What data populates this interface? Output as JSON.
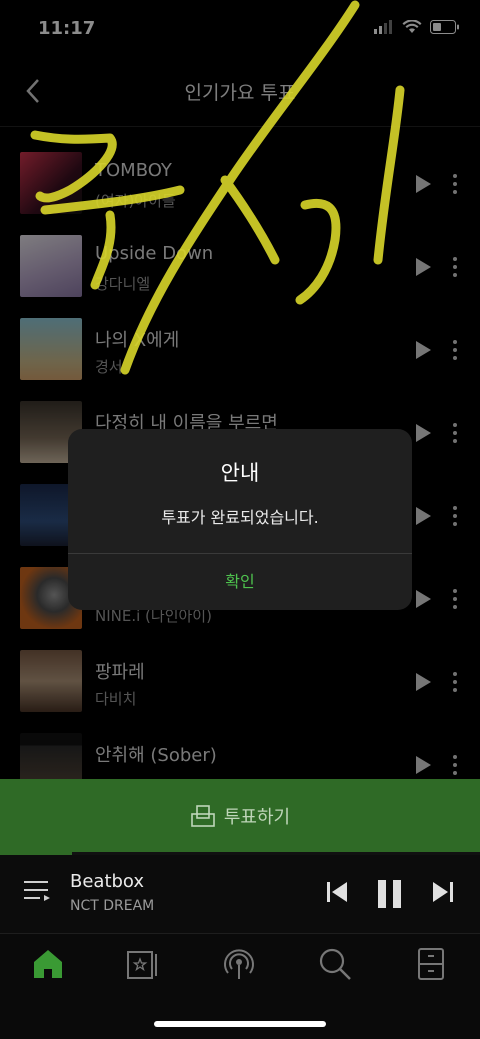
{
  "status_bar": {
    "time": "11:17"
  },
  "header": {
    "title": "인기가요 투표"
  },
  "songs": [
    {
      "title": "TOMBOY",
      "artist": "(여자)아이들"
    },
    {
      "title": "Upside Down",
      "artist": "강다니엘"
    },
    {
      "title": "나의 X에게",
      "artist": "경서"
    },
    {
      "title": "다정히 내 이름을 부르면",
      "artist": ""
    },
    {
      "title": "",
      "artist": ""
    },
    {
      "title": "",
      "artist": "NINE.i (나인아이)"
    },
    {
      "title": "팡파레",
      "artist": "다비치"
    },
    {
      "title": "안취해 (Sober)",
      "artist": ""
    }
  ],
  "vote_button": {
    "label": "투표하기"
  },
  "playback": {
    "progress": 0.15
  },
  "player": {
    "song": "Beatbox",
    "artist": "NCT DREAM"
  },
  "dialog": {
    "title": "안내",
    "message": "투표가 완료되었습니다.",
    "confirm": "확인"
  },
  "colors": {
    "accent": "#4ec24e",
    "vote_bar": "#2f6a26",
    "scribble": "#d9d62a"
  },
  "icons": [
    "back-icon",
    "play-icon",
    "more-icon",
    "vote-icon",
    "playlist-icon",
    "previous-icon",
    "pause-icon",
    "next-icon",
    "home-icon",
    "library-icon",
    "podcast-icon",
    "search-icon",
    "storage-icon"
  ]
}
